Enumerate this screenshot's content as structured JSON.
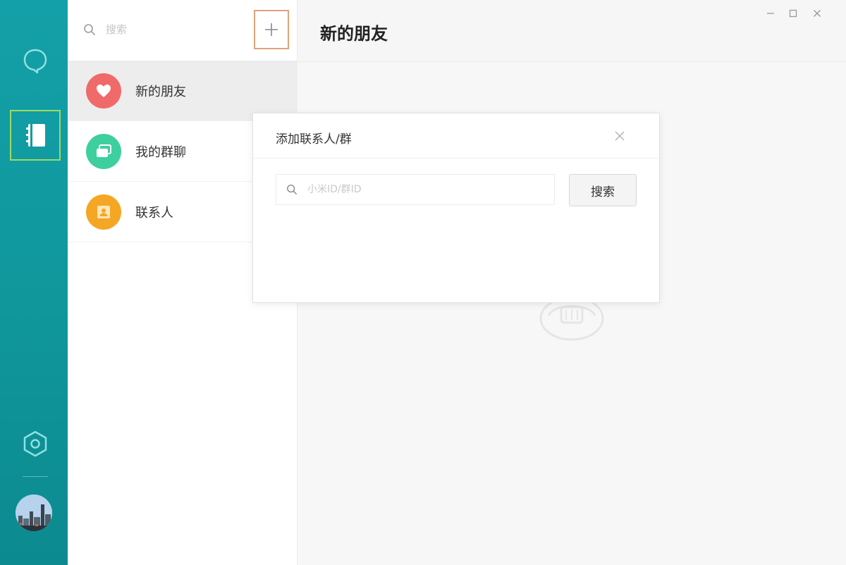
{
  "colors": {
    "rail_bg": "#12999f",
    "rail_selected_border": "#9bdc60",
    "add_button_border": "#e0a27a",
    "new_friends_icon": "#f06a6a",
    "group_chats_icon": "#3ecf9e",
    "contacts_icon": "#f5a623"
  },
  "rail": {
    "items": [
      {
        "icon": "chat-bubble-icon"
      },
      {
        "icon": "contacts-book-icon",
        "selected": true
      },
      {
        "icon": "settings-hexagon-icon"
      }
    ],
    "avatar_icon": "user-avatar"
  },
  "sidebar": {
    "search_placeholder": "搜索",
    "add_icon": "plus-icon",
    "items": [
      {
        "label": "新的朋友",
        "icon": "heart-icon",
        "active": true
      },
      {
        "label": "我的群聊",
        "icon": "group-chat-icon"
      },
      {
        "label": "联系人",
        "icon": "person-card-icon"
      }
    ]
  },
  "main": {
    "title": "新的朋友",
    "window_controls": [
      "minimize-icon",
      "maximize-icon",
      "close-icon"
    ]
  },
  "dialog": {
    "title": "添加联系人/群",
    "search_placeholder": "小米ID/群ID",
    "search_button": "搜索"
  }
}
